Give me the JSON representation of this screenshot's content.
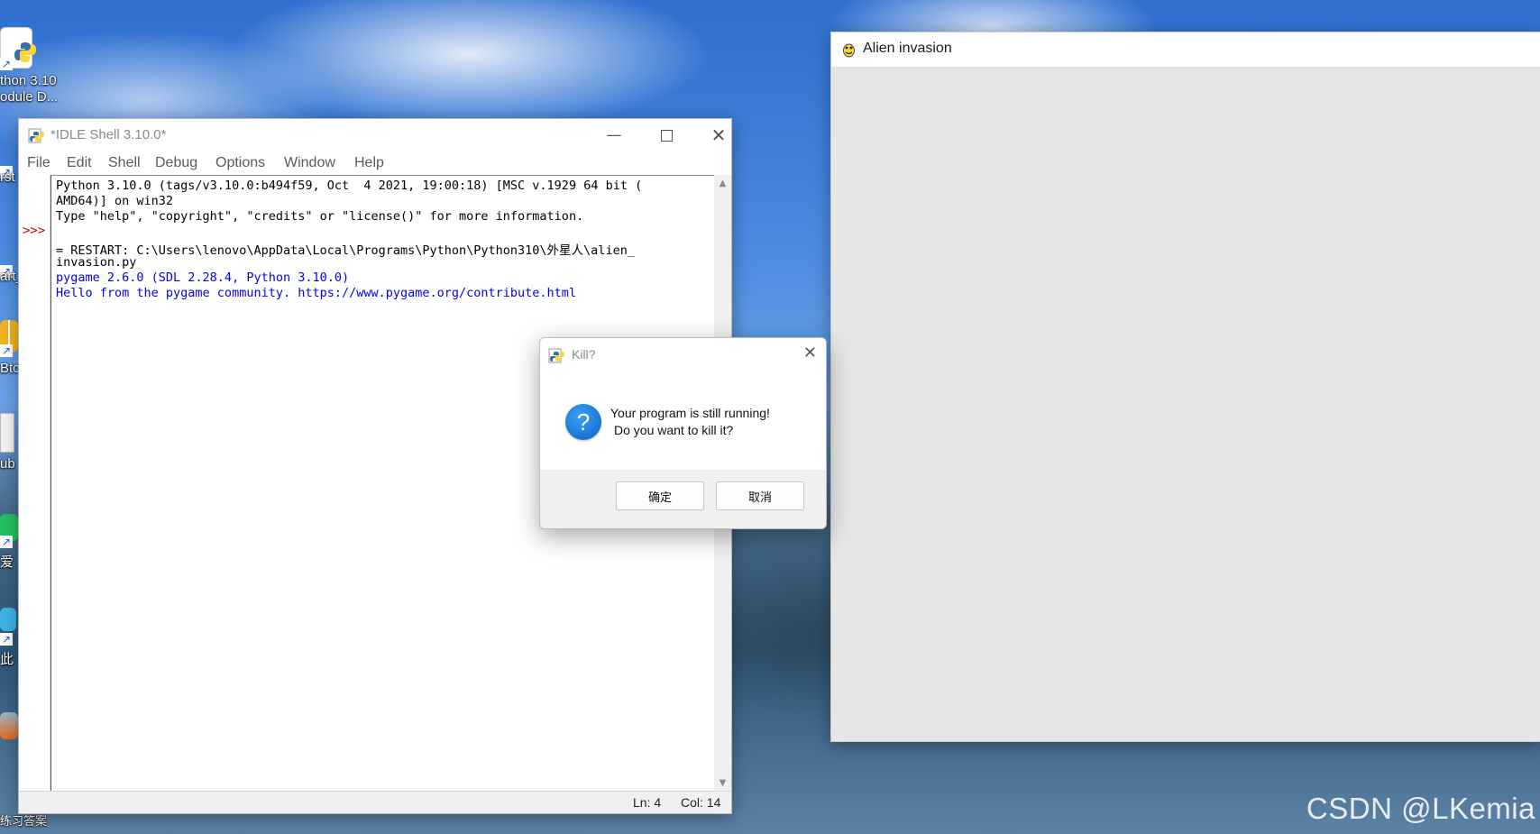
{
  "desktop": {
    "icons": [
      {
        "label_line1": "thon 3.10",
        "label_line2": "odule D..."
      },
      {
        "label": "rst"
      },
      {
        "label": "art_"
      },
      {
        "label": "Btc"
      },
      {
        "label": "ub"
      },
      {
        "label": "爱"
      },
      {
        "label": "此"
      },
      {
        "label": "练习答案"
      }
    ],
    "watermark": "CSDN @LKemia"
  },
  "idle_window": {
    "title": "*IDLE Shell 3.10.0*",
    "menu": [
      "File",
      "Edit",
      "Shell",
      "Debug",
      "Options",
      "Window",
      "Help"
    ],
    "prompt": ">>>",
    "lines": [
      "Python 3.10.0 (tags/v3.10.0:b494f59, Oct  4 2021, 19:00:18) [MSC v.1929 64 bit (",
      "AMD64)] on win32",
      "Type \"help\", \"copyright\", \"credits\" or \"license()\" for more information.",
      "",
      "= RESTART: C:\\Users\\lenovo\\AppData\\Local\\Programs\\Python\\Python310\\外星人\\alien_",
      "invasion.py",
      "pygame 2.6.0 (SDL 2.28.4, Python 3.10.0)",
      "Hello from the pygame community. https://www.pygame.org/contribute.html"
    ],
    "status": {
      "ln": "Ln: 4",
      "col": "Col: 14"
    }
  },
  "pygame_window": {
    "title": "Alien invasion"
  },
  "dialog": {
    "title": "Kill?",
    "message_line1": "Your program is still running!",
    "message_line2": "Do you want to kill it?",
    "ok_label": "确定",
    "cancel_label": "取消"
  }
}
